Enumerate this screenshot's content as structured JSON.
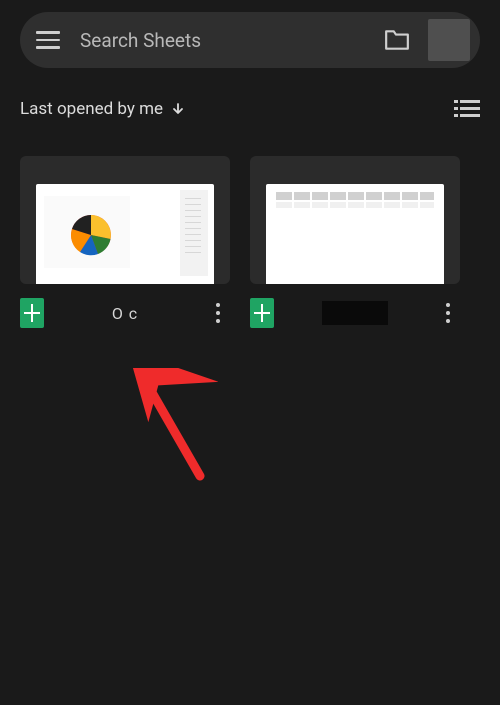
{
  "search": {
    "placeholder": "Search Sheets"
  },
  "sort": {
    "label": "Last opened by me"
  },
  "files": [
    {
      "title": "O c"
    },
    {
      "title": ""
    }
  ]
}
